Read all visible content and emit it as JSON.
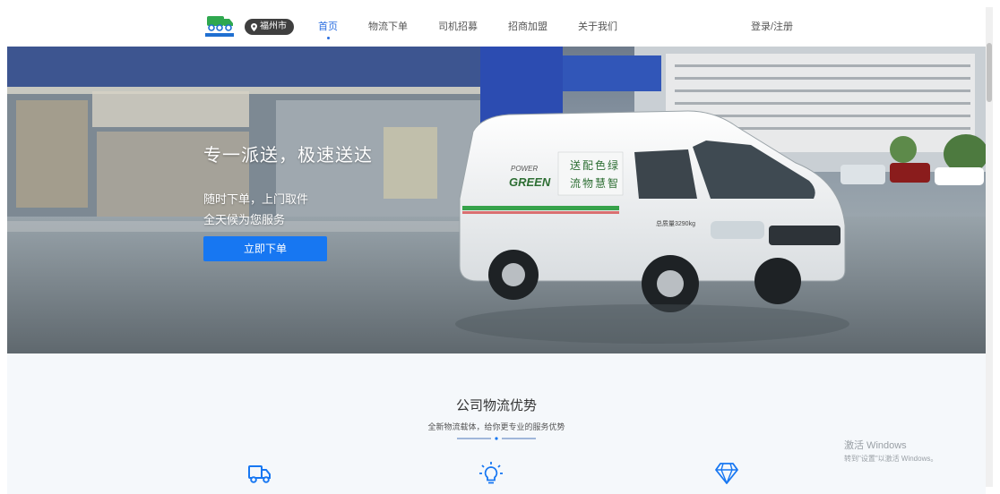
{
  "header": {
    "logo_name": "logo-icon",
    "city": "福州市",
    "nav": [
      {
        "label": "首页",
        "active": true
      },
      {
        "label": "物流下单",
        "active": false
      },
      {
        "label": "司机招募",
        "active": false
      },
      {
        "label": "招商加盟",
        "active": false
      },
      {
        "label": "关于我们",
        "active": false
      }
    ],
    "login": "登录/注册"
  },
  "hero": {
    "title": "专一派送，极速送达",
    "line1": "随时下单，上门取件",
    "line2": "全天候为您服务",
    "button": "立即下单",
    "van_text_power": "POWER",
    "van_text_green": "GREEN",
    "van_slogan_1": "送配色绿",
    "van_slogan_2": "流物慧智",
    "van_weight": "总质量3290kg"
  },
  "section": {
    "title": "公司物流优势",
    "subtitle": "全新物流载体，给你更专业的服务优势",
    "icons": [
      "truck-icon",
      "lightbulb-icon",
      "diamond-icon"
    ]
  },
  "watermark": {
    "line1": "激活 Windows",
    "line2": "转到\"设置\"以激活 Windows。"
  },
  "colors": {
    "accent": "#1777f2",
    "nav_active": "#2a6ee0"
  }
}
